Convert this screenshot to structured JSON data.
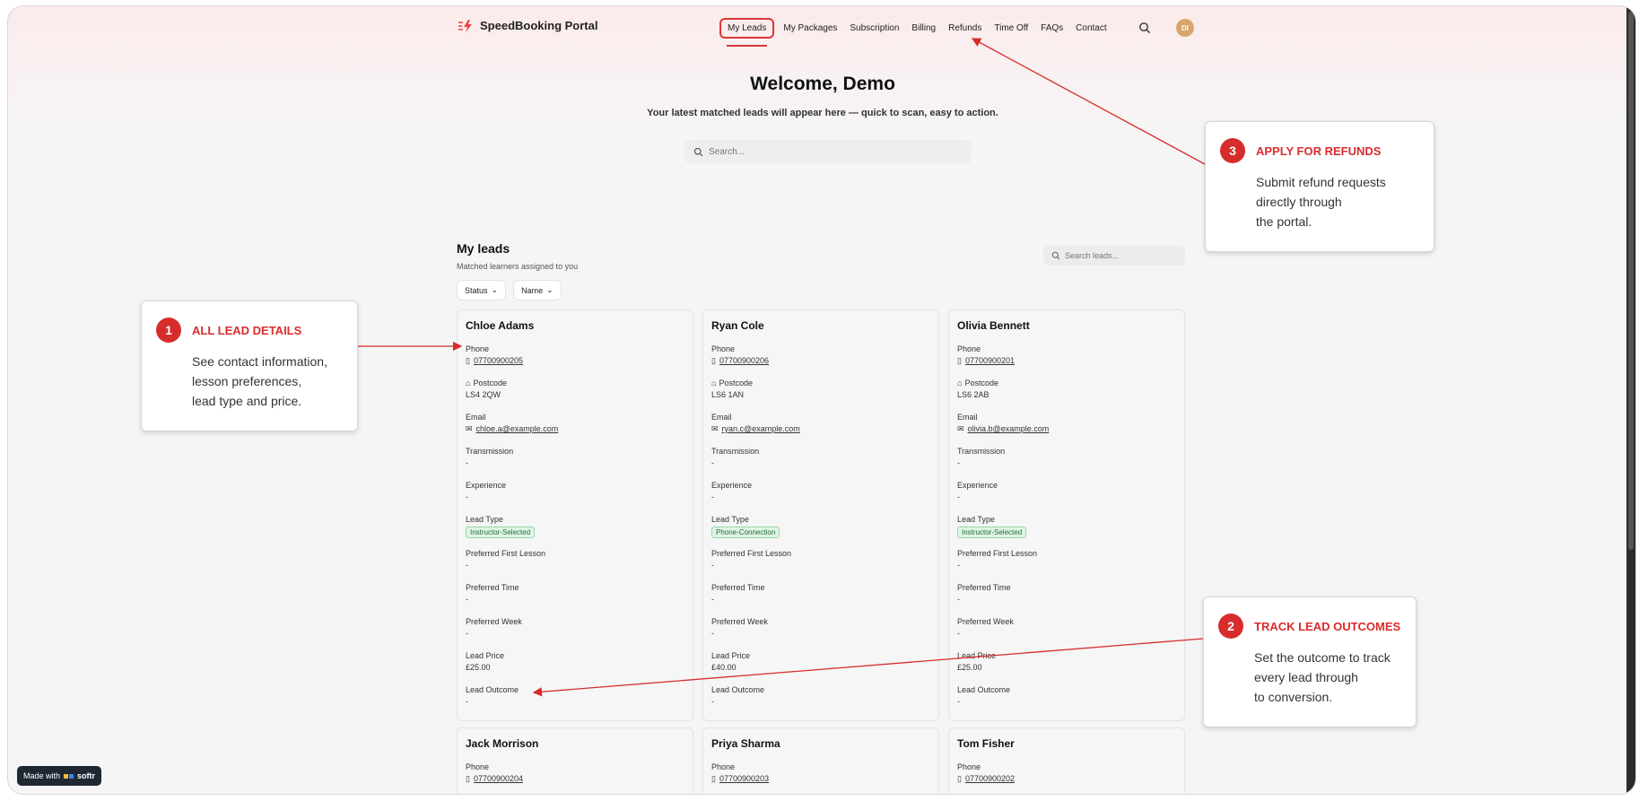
{
  "app": {
    "title": "SpeedBooking Portal"
  },
  "nav": {
    "items": [
      {
        "label": "My Leads",
        "active": true
      },
      {
        "label": "My Packages"
      },
      {
        "label": "Subscription"
      },
      {
        "label": "Billing"
      },
      {
        "label": "Refunds"
      },
      {
        "label": "Time Off"
      },
      {
        "label": "FAQs"
      },
      {
        "label": "Contact"
      }
    ],
    "avatar_initials": "DI"
  },
  "hero": {
    "title": "Welcome, Demo",
    "subtitle": "Your latest matched leads will appear here — quick to scan, easy to action.",
    "search_placeholder": "Search..."
  },
  "leads": {
    "title": "My leads",
    "subtitle": "Matched learners assigned to you",
    "search_placeholder": "Search leads...",
    "filters": [
      "Status",
      "Name"
    ],
    "field_labels": {
      "phone": "Phone",
      "postcode": "Postcode",
      "email": "Email",
      "transmission": "Transmission",
      "experience": "Experience",
      "lead_type": "Lead Type",
      "first_lesson": "Preferred First Lesson",
      "time": "Preferred Time",
      "week": "Preferred Week",
      "price": "Lead Price",
      "outcome": "Lead Outcome"
    },
    "cards": [
      {
        "name": "Chloe Adams",
        "phone": "07700900205",
        "postcode": "LS4 2QW",
        "email": "chloe.a@example.com",
        "transmission": "-",
        "experience": "-",
        "lead_type": "Instructor-Selected",
        "first_lesson": "-",
        "time": "-",
        "week": "-",
        "price": "£25.00",
        "outcome": "-"
      },
      {
        "name": "Ryan Cole",
        "phone": "07700900206",
        "postcode": "LS6 1AN",
        "email": "ryan.c@example.com",
        "transmission": "-",
        "experience": "-",
        "lead_type": "Phone-Connection",
        "first_lesson": "-",
        "time": "-",
        "week": "-",
        "price": "£40.00",
        "outcome": "-"
      },
      {
        "name": "Olivia Bennett",
        "phone": "07700900201",
        "postcode": "LS6 2AB",
        "email": "olivia.b@example.com",
        "transmission": "-",
        "experience": "-",
        "lead_type": "Instructor-Selected",
        "first_lesson": "-",
        "time": "-",
        "week": "-",
        "price": "£25.00",
        "outcome": "-"
      },
      {
        "name": "Jack Morrison",
        "phone": "07700900204"
      },
      {
        "name": "Priya Sharma",
        "phone": "07700900203"
      },
      {
        "name": "Tom Fisher",
        "phone": "07700900202"
      }
    ]
  },
  "callouts": [
    {
      "number": "1",
      "title": "ALL LEAD DETAILS",
      "body": [
        "See contact information,",
        "lesson preferences,",
        "lead type and price."
      ]
    },
    {
      "number": "2",
      "title": "TRACK LEAD OUTCOMES",
      "body": [
        "Set the outcome to track",
        "every lead through",
        "to conversion."
      ]
    },
    {
      "number": "3",
      "title": "APPLY FOR REFUNDS",
      "body": [
        "Submit refund requests",
        "directly through",
        "the portal."
      ]
    }
  ],
  "footer_badge": {
    "label": "Made with",
    "brand": "softr"
  },
  "colors": {
    "accent": "#d72c2c",
    "badge_bg": "#dff5e4",
    "badge_text": "#23683a"
  }
}
